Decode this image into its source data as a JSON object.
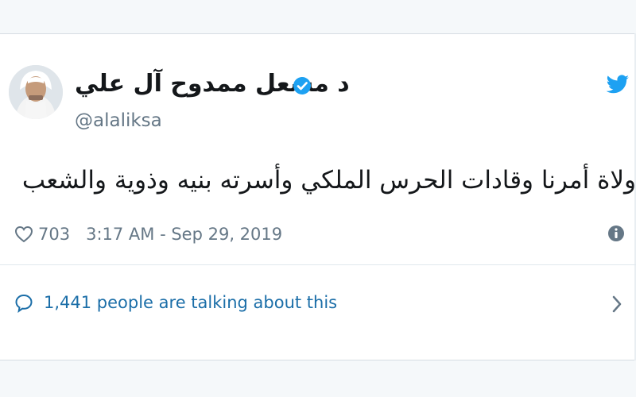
{
  "tweet": {
    "display_name": "د مشعل ممدوح آل علي",
    "handle": "@alaliksa",
    "text": "ولاة أمرنا وقادات الحرس الملكي وأسرته بنيه وذوية والشعب السعودي",
    "likes": "703",
    "timestamp": "3:17 AM - Sep 29, 2019",
    "conversation": "1,441 people are talking about this"
  },
  "icons": {
    "brand": "twitter-bird-icon",
    "verified": "verified-badge-icon",
    "like": "heart-icon",
    "info": "info-icon",
    "reply": "speech-bubble-icon",
    "more": "chevron-right-icon"
  },
  "colors": {
    "twitter_blue": "#1da1f2",
    "link_blue": "#1b6ea8",
    "text": "#14171a",
    "secondary_text": "#657786",
    "background": "#f5f8fa"
  }
}
